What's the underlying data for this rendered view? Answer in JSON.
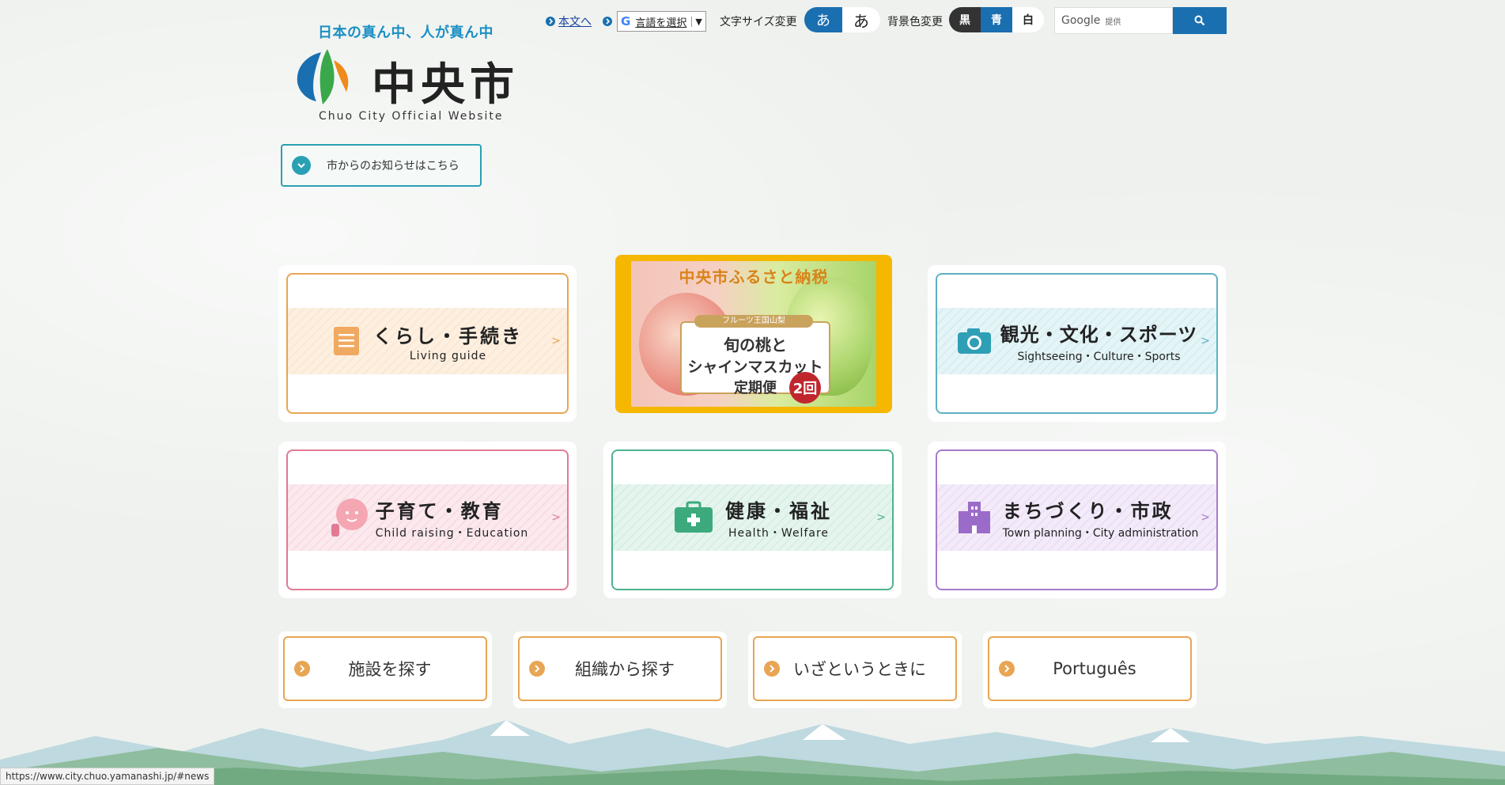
{
  "header": {
    "tagline": "日本の真ん中、人が真ん中",
    "logo_text": "中央市",
    "logo_sub": "Chuo City Official Website",
    "news_button": "市からのお知らせはこちら"
  },
  "topbar": {
    "skip_link": "本文へ",
    "language_select": "言語を選択",
    "text_size_label": "文字サイズ変更",
    "text_size_small": "あ",
    "text_size_large": "あ",
    "bg_color_label": "背景色変更",
    "bg_black": "黒",
    "bg_blue": "青",
    "bg_white": "白",
    "search_brand": "Google",
    "search_provided": "提供"
  },
  "cards": [
    {
      "title": "くらし・手続き",
      "sub": "Living guide",
      "color": "#e8a553",
      "band": "#fdf0e1",
      "icon": "document-icon"
    },
    {
      "title": "観光・文化・スポーツ",
      "sub": "Sightseeing・Culture・Sports",
      "color": "#5eb1c4",
      "band": "#e5f4f6",
      "icon": "camera-icon"
    },
    {
      "title": "子育て・教育",
      "sub": "Child raising・Education",
      "color": "#e27a93",
      "band": "#fbe9ee",
      "icon": "baby-icon"
    },
    {
      "title": "健康・福祉",
      "sub": "Health・Welfare",
      "color": "#4db38b",
      "band": "#e5f5ee",
      "icon": "medical-kit-icon"
    },
    {
      "title": "まちづくり・市政",
      "sub": "Town planning・City administration",
      "color": "#a77bcc",
      "band": "#f3ebf9",
      "icon": "building-icon"
    }
  ],
  "promo": {
    "headline": "中央市ふるさと納税",
    "badge": "フルーツ王国山梨",
    "line1": "旬の桃と",
    "line2": "シャインマスカット",
    "line3": "定期便",
    "count": "2回"
  },
  "quick_links": [
    "施設を探す",
    "組織から探す",
    "いざというときに",
    "Português"
  ],
  "status_url": "https://www.city.chuo.yamanashi.jp/#news"
}
